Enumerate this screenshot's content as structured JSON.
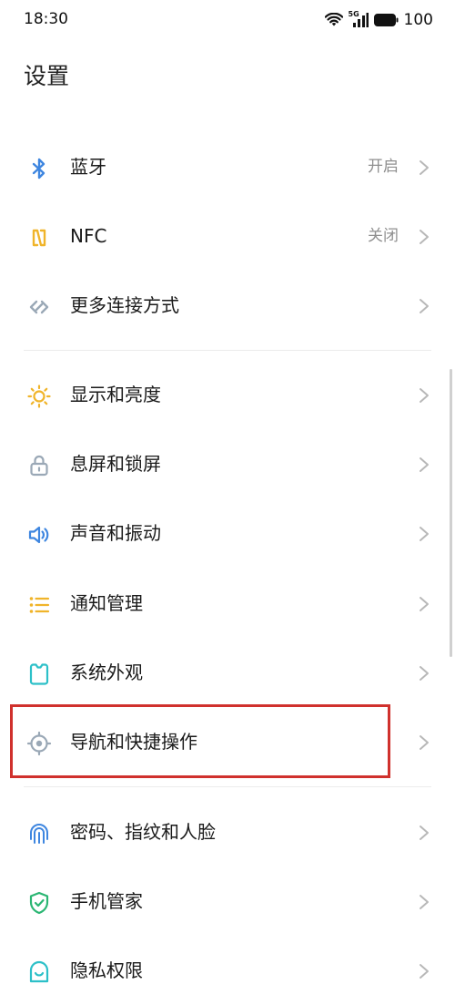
{
  "status": {
    "time": "18:30",
    "signal_label": "5G",
    "battery_level": "100"
  },
  "page": {
    "title": "设置"
  },
  "colors": {
    "bluetooth": "#3e86e0",
    "nfc": "#f0b42a",
    "more_connection": "#9aa8b6",
    "display": "#f0b42a",
    "lock": "#9aa8b6",
    "sound": "#3e86e0",
    "notify": "#f0b42a",
    "appearance": "#2cc0c8",
    "navigation": "#9aa8b6",
    "fingerprint": "#3e86e0",
    "phone_manager": "#2bb673",
    "privacy": "#2cc0c8",
    "highlight": "#d0312d"
  },
  "settings": {
    "bluetooth": {
      "label": "蓝牙",
      "value": "开启",
      "icon": "bluetooth-icon"
    },
    "nfc": {
      "label": "NFC",
      "value": "关闭",
      "icon": "nfc-icon"
    },
    "more_connection": {
      "label": "更多连接方式",
      "icon": "link-icon"
    },
    "display": {
      "label": "显示和亮度",
      "icon": "sun-icon"
    },
    "lock": {
      "label": "息屏和锁屏",
      "icon": "lock-icon"
    },
    "sound": {
      "label": "声音和振动",
      "icon": "speaker-icon"
    },
    "notify": {
      "label": "通知管理",
      "icon": "list-icon"
    },
    "appearance": {
      "label": "系统外观",
      "icon": "appearance-icon"
    },
    "navigation": {
      "label": "导航和快捷操作",
      "icon": "navigation-icon"
    },
    "fingerprint": {
      "label": "密码、指纹和人脸",
      "icon": "fingerprint-icon"
    },
    "phone_manager": {
      "label": "手机管家",
      "icon": "shield-icon"
    },
    "privacy": {
      "label": "隐私权限",
      "icon": "privacy-icon"
    }
  }
}
